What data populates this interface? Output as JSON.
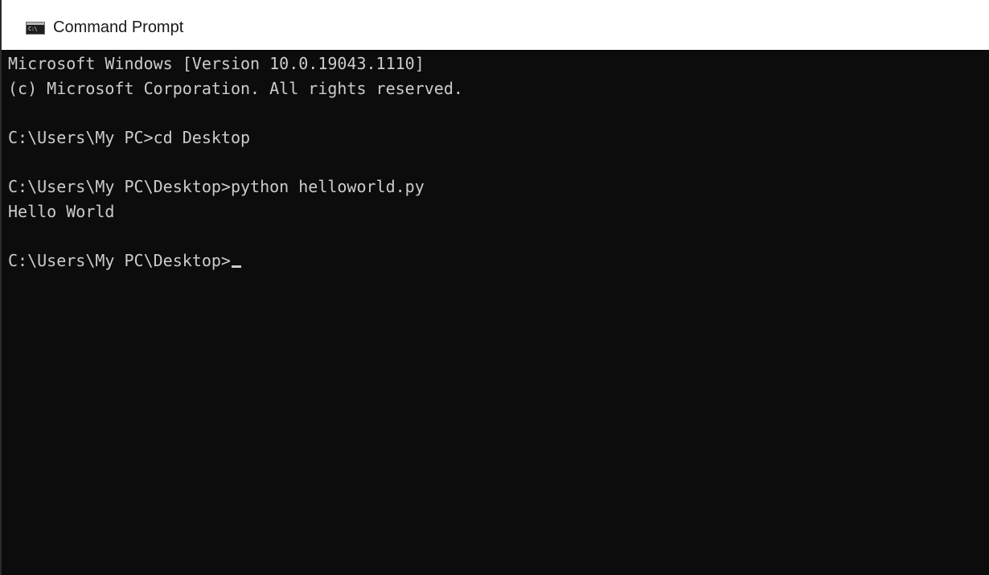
{
  "window": {
    "title": "Command Prompt",
    "icon": "terminal-icon",
    "icon_text": "C:\\"
  },
  "console": {
    "background": "#0c0c0c",
    "foreground": "#cccccc",
    "lines": [
      "Microsoft Windows [Version 10.0.19043.1110]",
      "(c) Microsoft Corporation. All rights reserved.",
      "",
      "C:\\Users\\My PC>cd Desktop",
      "",
      "C:\\Users\\My PC\\Desktop>python helloworld.py",
      "Hello World",
      "",
      "C:\\Users\\My PC\\Desktop>"
    ]
  }
}
